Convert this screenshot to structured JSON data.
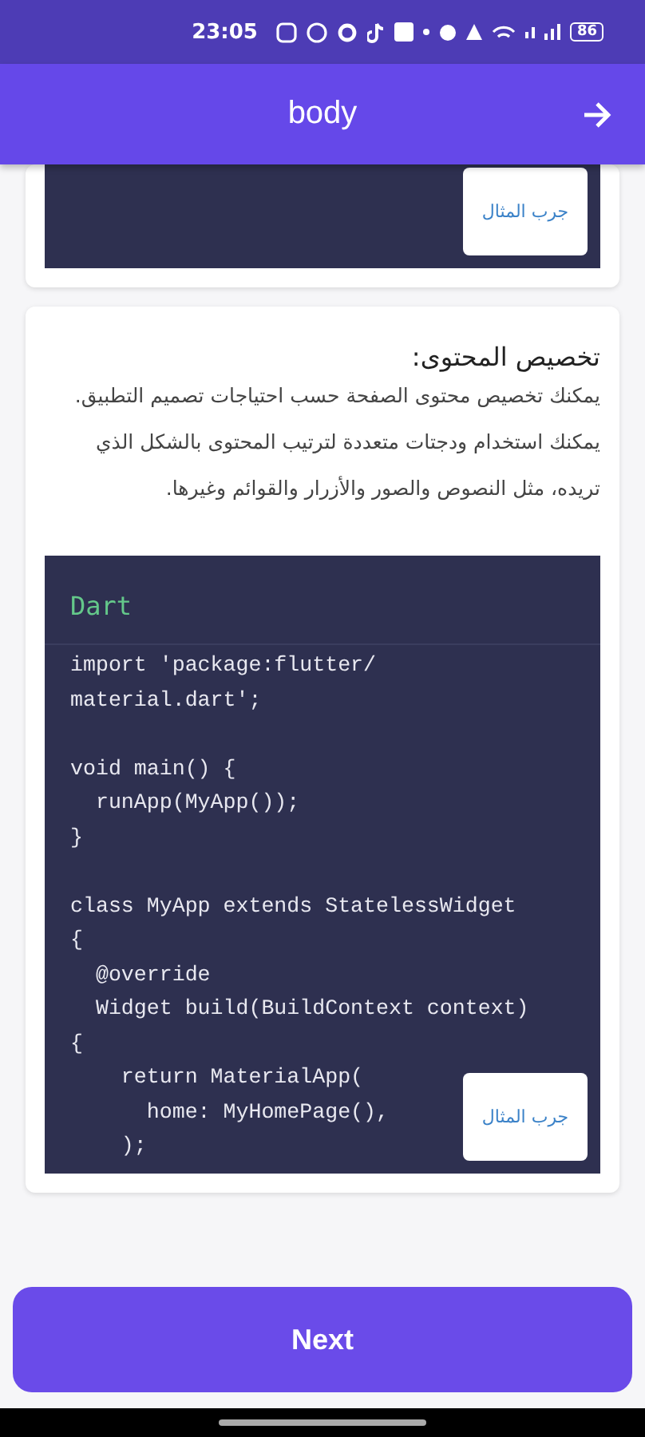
{
  "status_bar": {
    "time": "23:05",
    "battery": "86"
  },
  "app_bar": {
    "title": "body"
  },
  "sections": [
    {
      "try_button": "جرب المثال"
    },
    {
      "heading": "تخصيص المحتوى:",
      "body": "يمكنك تخصيص محتوى الصفحة حسب احتياجات تصميم التطبيق. يمكنك استخدام ودجتات متعددة لترتيب المحتوى بالشكل الذي تريده، مثل النصوص والصور والأزرار والقوائم وغيرها.",
      "language": "Dart",
      "code_paragraphs": [
        [
          "import 'package:flutter/",
          "material.dart';"
        ],
        [
          "void main() {",
          "  runApp(MyApp());",
          "}"
        ],
        [
          "class MyApp extends StatelessWidget",
          "{",
          "  @override",
          "  Widget build(BuildContext context)",
          "{",
          "    return MaterialApp(",
          "      home: MyHomePage(),",
          "    );"
        ]
      ],
      "try_button": "جرب المثال"
    }
  ],
  "next_button": "Next"
}
